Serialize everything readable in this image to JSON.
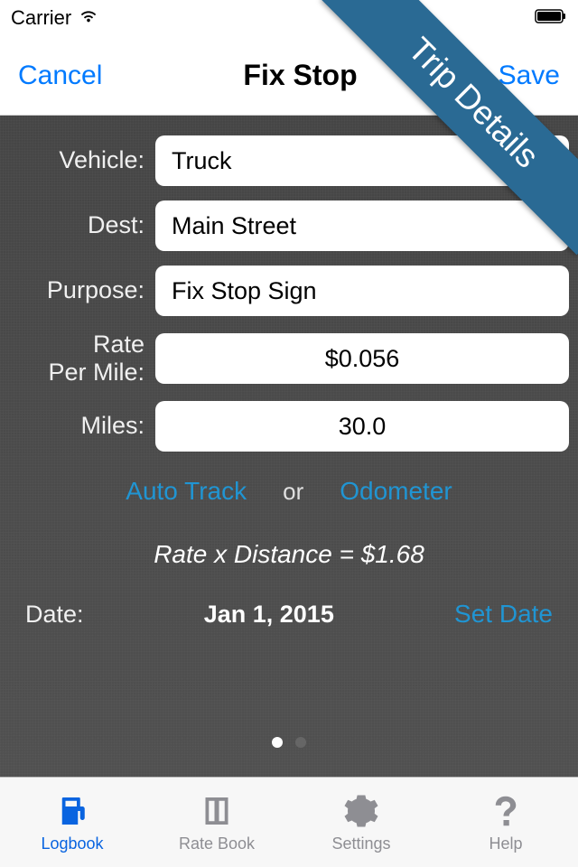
{
  "status": {
    "carrier": "Carrier"
  },
  "nav": {
    "cancel": "Cancel",
    "title": "Fix Stop",
    "save": "Save"
  },
  "ribbon": "Trip Details",
  "form": {
    "vehicle_label": "Vehicle:",
    "vehicle_value": "Truck",
    "dest_label": "Dest:",
    "dest_value": "Main Street",
    "purpose_label": "Purpose:",
    "purpose_value": "Fix Stop Sign",
    "rate_label": "Rate Per Mile:",
    "rate_value": "$0.056",
    "miles_label": "Miles:",
    "miles_value": "30.0"
  },
  "track": {
    "auto": "Auto Track",
    "or": "or",
    "odometer": "Odometer"
  },
  "calc": "Rate x Distance = $1.68",
  "date": {
    "label": "Date:",
    "value": "Jan 1, 2015",
    "set": "Set Date"
  },
  "tabs": {
    "logbook": "Logbook",
    "ratebook": "Rate Book",
    "settings": "Settings",
    "help": "Help"
  }
}
